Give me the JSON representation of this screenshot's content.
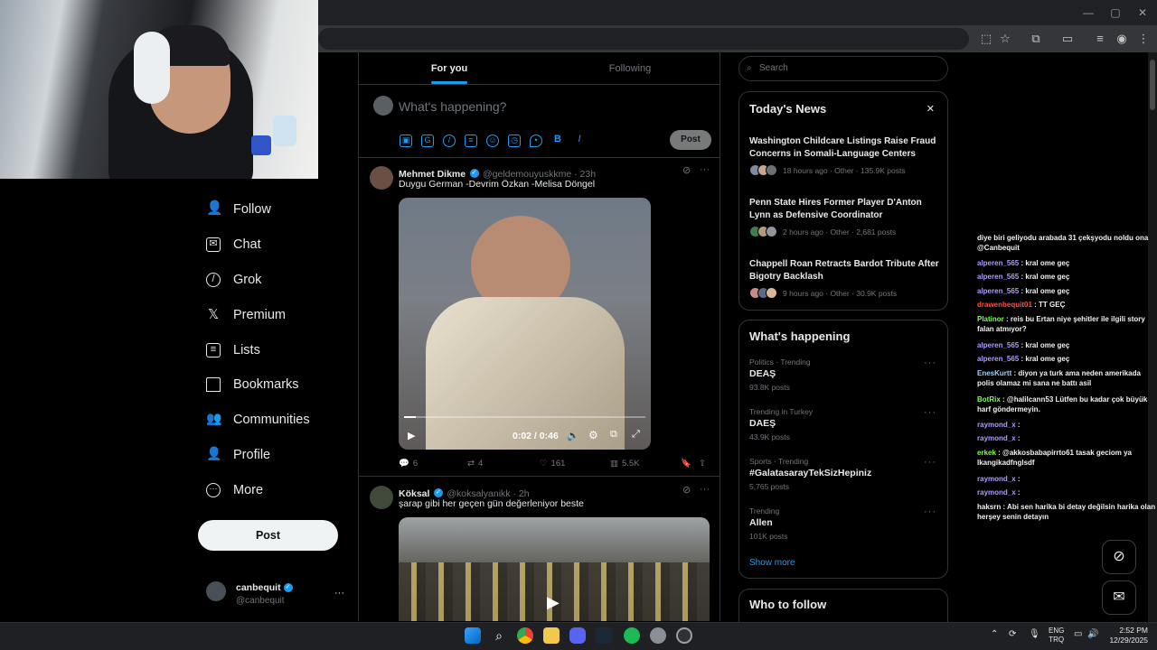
{
  "browser": {
    "title_buttons": {
      "minimize": "—",
      "maximize": "▢",
      "close": "✕"
    },
    "toolbar_icons": [
      "install-app-icon",
      "bookmark-star-icon",
      "extensions-icon",
      "sidebar-icon",
      "reading-list-icon",
      "profile-icon",
      "more-menu-icon"
    ]
  },
  "sidebar": {
    "items": [
      {
        "label": "Follow",
        "icon": "add-person-icon"
      },
      {
        "label": "Chat",
        "icon": "mail-icon"
      },
      {
        "label": "Grok",
        "icon": "grok-icon"
      },
      {
        "label": "Premium",
        "icon": "x-logo-icon"
      },
      {
        "label": "Lists",
        "icon": "list-icon"
      },
      {
        "label": "Bookmarks",
        "icon": "bookmark-icon"
      },
      {
        "label": "Communities",
        "icon": "people-icon"
      },
      {
        "label": "Profile",
        "icon": "person-icon"
      },
      {
        "label": "More",
        "icon": "more-circle-icon"
      }
    ],
    "post_label": "Post",
    "account": {
      "name": "canbequit",
      "handle": "@canbequit",
      "more": "···"
    }
  },
  "tabs": {
    "for_you": "For you",
    "following": "Following"
  },
  "composer": {
    "placeholder": "What's happening?",
    "post_label": "Post"
  },
  "tweets": [
    {
      "name": "Mehmet Dikme",
      "handle": "@geldemouyuskkme · 23h",
      "text": "Duygu German -Devrim Özkan -Melisa Döngel",
      "video_time": "0:02 / 0:46",
      "replies": "6",
      "reposts": "4",
      "likes": "161",
      "views": "5.5K"
    },
    {
      "name": "Köksal",
      "handle": "@koksalyanikk · 2h",
      "text": "şarap gibi her geçen gün değerleniyor beste"
    }
  ],
  "search": {
    "placeholder": "Search"
  },
  "todays_news": {
    "title": "Today's News",
    "close": "✕",
    "items": [
      {
        "title": "Washington Childcare Listings Raise Fraud Concerns in Somali-Language Centers",
        "meta": "18 hours ago · Other · 135.9K posts"
      },
      {
        "title": "Penn State Hires Former Player D'Anton Lynn as Defensive Coordinator",
        "meta": "2 hours ago · Other · 2,681 posts"
      },
      {
        "title": "Chappell Roan Retracts Bardot Tribute After Bigotry Backlash",
        "meta": "9 hours ago · Other · 30.9K posts"
      }
    ]
  },
  "whats_happening": {
    "title": "What's happening",
    "trends": [
      {
        "category": "Politics · Trending",
        "name": "DEAŞ",
        "posts": "93.8K posts"
      },
      {
        "category": "Trending in Turkey",
        "name": "DAEŞ",
        "posts": "43.9K posts"
      },
      {
        "category": "Sports · Trending",
        "name": "#GalatasarayTekSizHepiniz",
        "posts": "5,765 posts"
      },
      {
        "category": "Trending",
        "name": "Allen",
        "posts": "101K posts"
      }
    ],
    "show_more": "Show more"
  },
  "who_to_follow": {
    "title": "Who to follow"
  },
  "chat": {
    "lines": [
      {
        "user": "",
        "text": "diye biri geliyodu arabada 31 çekşyodu noldu ona @Canbequit",
        "color": "#f1f1f1"
      },
      {
        "user": "alperen_565",
        "text": ": kral ome geç",
        "color": "#b09aff"
      },
      {
        "user": "alperen_565",
        "text": ": kral ome geç",
        "color": "#b09aff"
      },
      {
        "user": "alperen_565",
        "text": ": kral ome geç",
        "color": "#b09aff"
      },
      {
        "user": "drawenbequit01",
        "text": ": TT GEÇ",
        "color": "#ff4d4d"
      },
      {
        "user": "Platinor",
        "text": ": reis bu Ertan niye şehitler ile ilgili story falan atmıyor?",
        "color": "#7cff4d"
      },
      {
        "user": "alperen_565",
        "text": ": kral ome geç",
        "color": "#b09aff"
      },
      {
        "user": "alperen_565",
        "text": ": kral ome geç",
        "color": "#b09aff"
      },
      {
        "user": "EnesKurtt",
        "text": ": diyon ya turk ama neden amerikada polis olamaz mi sana ne battı asil",
        "color": "#9ad4ff"
      },
      {
        "user": "BotRix",
        "text": ": @halilcann53 Lütfen bu kadar çok büyük harf göndermeyin.",
        "color": "#7cff4d"
      },
      {
        "user": "raymond_x",
        "text": ":",
        "color": "#b09aff"
      },
      {
        "user": "raymond_x",
        "text": ":",
        "color": "#b09aff"
      },
      {
        "user": "erkek",
        "text": ": @akkosbabapirrto61 tasak geciom ya lkangikadfnglsdf",
        "color": "#7cff4d"
      },
      {
        "user": "raymond_x",
        "text": ":",
        "color": "#b09aff"
      },
      {
        "user": "raymond_x",
        "text": ":",
        "color": "#b09aff"
      },
      {
        "user": "haksrn",
        "text": ": Abi sen harika bi detay değilsin harika olan herşey senin detayın",
        "color": "#f1f1f1"
      }
    ]
  },
  "taskbar": {
    "language": "ENG",
    "region": "TRQ",
    "time": "2:52 PM",
    "date": "12/29/2025"
  }
}
